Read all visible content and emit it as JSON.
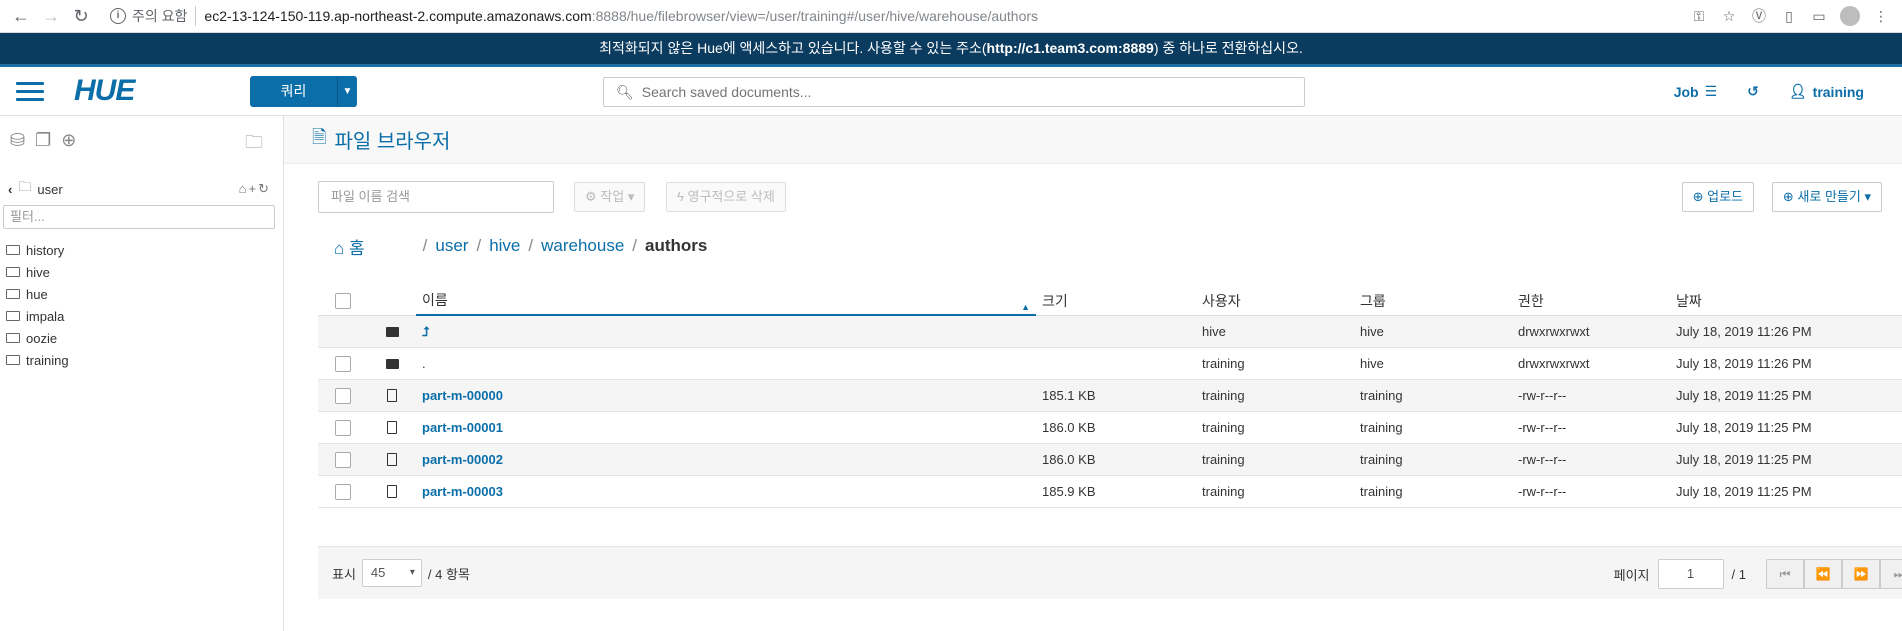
{
  "browser": {
    "warning": "주의 요함",
    "url_host": "ec2-13-124-150-119.ap-northeast-2.compute.amazonaws.com",
    "url_path": ":8888/hue/filebrowser/view=/user/training#/user/hive/warehouse/authors"
  },
  "banner": {
    "text_before": "최적화되지 않은 Hue에 액세스하고 있습니다. 사용할 수 있는 주소(",
    "link": "http://c1.team3.com:8889",
    "text_after": ") 중 하나로 전환하십시오."
  },
  "topnav": {
    "logo": "HUE",
    "query_button": "쿼리",
    "search_placeholder": "Search saved documents...",
    "job_label": "Job",
    "user_label": "training"
  },
  "sidebar": {
    "path_label": "user",
    "filter_placeholder": "필터...",
    "items": [
      "history",
      "hive",
      "hue",
      "impala",
      "oozie",
      "training"
    ]
  },
  "main": {
    "title": "파일 브라우저",
    "file_search_placeholder": "파일 이름 검색",
    "actions_button": "작업",
    "delete_button": "영구적으로 삭제",
    "upload_button": "업로드",
    "new_button": "새로 만들기"
  },
  "breadcrumbs": {
    "home": "홈",
    "parts": [
      "user",
      "hive",
      "warehouse"
    ],
    "current": "authors"
  },
  "table": {
    "headers": {
      "name": "이름",
      "size": "크기",
      "user": "사용자",
      "group": "그룹",
      "perm": "권한",
      "date": "날짜"
    },
    "rows": [
      {
        "type": "folder",
        "name": "⮥",
        "size": "",
        "user": "hive",
        "group": "hive",
        "perm": "drwxrwxrwxt",
        "date": "July 18, 2019 11:26 PM"
      },
      {
        "type": "folder",
        "name": ".",
        "size": "",
        "user": "training",
        "group": "hive",
        "perm": "drwxrwxrwxt",
        "date": "July 18, 2019 11:26 PM"
      },
      {
        "type": "file",
        "name": "part-m-00000",
        "size": "185.1 KB",
        "user": "training",
        "group": "training",
        "perm": "-rw-r--r--",
        "date": "July 18, 2019 11:25 PM"
      },
      {
        "type": "file",
        "name": "part-m-00001",
        "size": "186.0 KB",
        "user": "training",
        "group": "training",
        "perm": "-rw-r--r--",
        "date": "July 18, 2019 11:25 PM"
      },
      {
        "type": "file",
        "name": "part-m-00002",
        "size": "186.0 KB",
        "user": "training",
        "group": "training",
        "perm": "-rw-r--r--",
        "date": "July 18, 2019 11:25 PM"
      },
      {
        "type": "file",
        "name": "part-m-00003",
        "size": "185.9 KB",
        "user": "training",
        "group": "training",
        "perm": "-rw-r--r--",
        "date": "July 18, 2019 11:25 PM"
      }
    ]
  },
  "footer": {
    "show_label": "표시",
    "per_page": "45",
    "total": "/ 4 항목",
    "page_label": "페이지",
    "page_value": "1",
    "page_total": "/ 1"
  },
  "colors": {
    "accent": "#0b6ea8",
    "banner": "#0b3b5f"
  }
}
